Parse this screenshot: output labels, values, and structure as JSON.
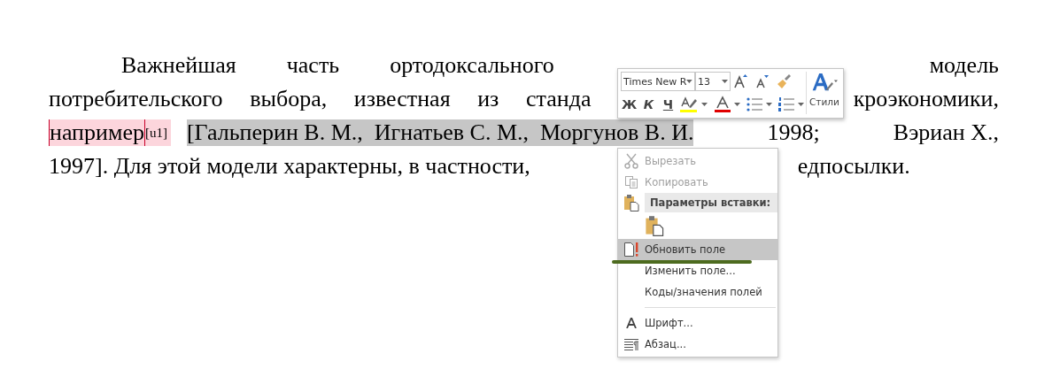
{
  "document": {
    "lines": [
      {
        "kind": "first",
        "words": [
          "Важнейшая",
          "часть",
          "ортодоксального",
          "модель"
        ]
      },
      {
        "kind": "gap",
        "words": [
          "потребительского",
          "выбора,",
          "известная",
          "из",
          "станда",
          "кроэкономики,"
        ]
      },
      {
        "kind": "comment",
        "comment_word": "например",
        "comment_mark": "[u1]",
        "selected_text": "[Гальперин В. М.,  Игнатьев С. М.,  Моргунов В. И.",
        "words": [
          "1998;",
          "Вэриан Х.,"
        ]
      },
      {
        "kind": "last",
        "words": [
          "1997]. Для этой модели характерны, в частности,",
          "едпосылки."
        ]
      }
    ]
  },
  "mini_toolbar": {
    "font_name": "Times New R",
    "font_size": "13",
    "styles_label": "Стили",
    "format_buttons": [
      {
        "kind": "bold",
        "label": "Ж"
      },
      {
        "kind": "italic",
        "label": "К"
      },
      {
        "kind": "underline",
        "label": "Ч"
      }
    ]
  },
  "context_menu": {
    "items": [
      {
        "kind": "cut",
        "label": "Вырезать",
        "disabled": true,
        "selected": false
      },
      {
        "kind": "copy",
        "label": "Копировать",
        "disabled": true,
        "selected": false
      },
      {
        "kind": "header",
        "label": "Параметры вставки:"
      },
      {
        "kind": "paste-options"
      },
      {
        "kind": "update",
        "label": "Обновить поле",
        "disabled": false,
        "selected": true
      },
      {
        "kind": "plain",
        "label": "Изменить поле...",
        "disabled": false,
        "selected": false
      },
      {
        "kind": "plain",
        "label": "Коды/значения полей",
        "disabled": false,
        "selected": false
      },
      {
        "kind": "separator"
      },
      {
        "kind": "font",
        "label": "Шрифт...",
        "disabled": false,
        "selected": false
      },
      {
        "kind": "paragraph",
        "label": "Абзац...",
        "disabled": false,
        "selected": false
      }
    ]
  }
}
